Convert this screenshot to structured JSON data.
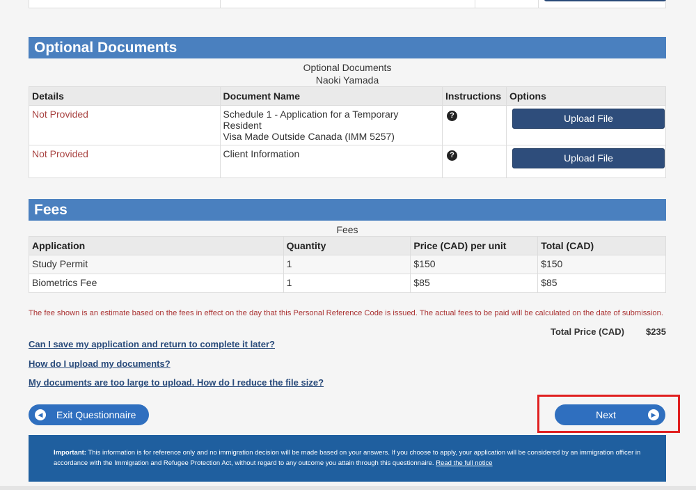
{
  "optional_documents": {
    "header": "Optional Documents",
    "caption_title": "Optional Documents",
    "caption_name": "Naoki Yamada",
    "columns": [
      "Details",
      "Document Name",
      "Instructions",
      "Options"
    ],
    "rows": [
      {
        "details": "Not Provided",
        "document_line1": "Schedule 1 - Application for a Temporary Resident",
        "document_line2": "Visa Made Outside Canada (IMM 5257)",
        "help_icon": "question-circle-icon",
        "button": "Upload File"
      },
      {
        "details": "Not Provided",
        "document_line1": "Client Information",
        "document_line2": "",
        "help_icon": "question-circle-icon",
        "button": "Upload File"
      }
    ]
  },
  "fees": {
    "header": "Fees",
    "caption": "Fees",
    "columns": [
      "Application",
      "Quantity",
      "Price (CAD) per unit",
      "Total (CAD)"
    ],
    "rows": [
      {
        "application": "Study Permit",
        "quantity": "1",
        "price": "$150",
        "total": "$150"
      },
      {
        "application": "Biometrics Fee",
        "quantity": "1",
        "price": "$85",
        "total": "$85"
      }
    ],
    "note": "The fee shown is an estimate based on the fees in effect on the day that this Personal Reference Code is issued. The actual fees to be paid will be calculated on the date of submission.",
    "total_label": "Total Price (CAD)",
    "total_value": "$235"
  },
  "faq_links": [
    "Can I save my application and return to complete it later?",
    "How do I upload my documents?",
    "My documents are too large to upload. How do I reduce the file size?"
  ],
  "navigation": {
    "exit_label": "Exit Questionnaire",
    "next_label": "Next"
  },
  "notice": {
    "important_label": "Important:",
    "text": " This information is for reference only and no immigration decision will be made based on your answers. If you choose to apply, your application will be considered by an immigration officer in accordance with the Immigration and Refugee Protection Act, without regard to any outcome you attain through this questionnaire. ",
    "link": "Read the full notice"
  },
  "colors": {
    "section_header": "#4a80bf",
    "button_dark": "#2e4d7b",
    "pill_blue": "#2f6fbf",
    "error_red": "#a94442",
    "notice_bg": "#1f5f9f",
    "highlight": "#e02020"
  }
}
